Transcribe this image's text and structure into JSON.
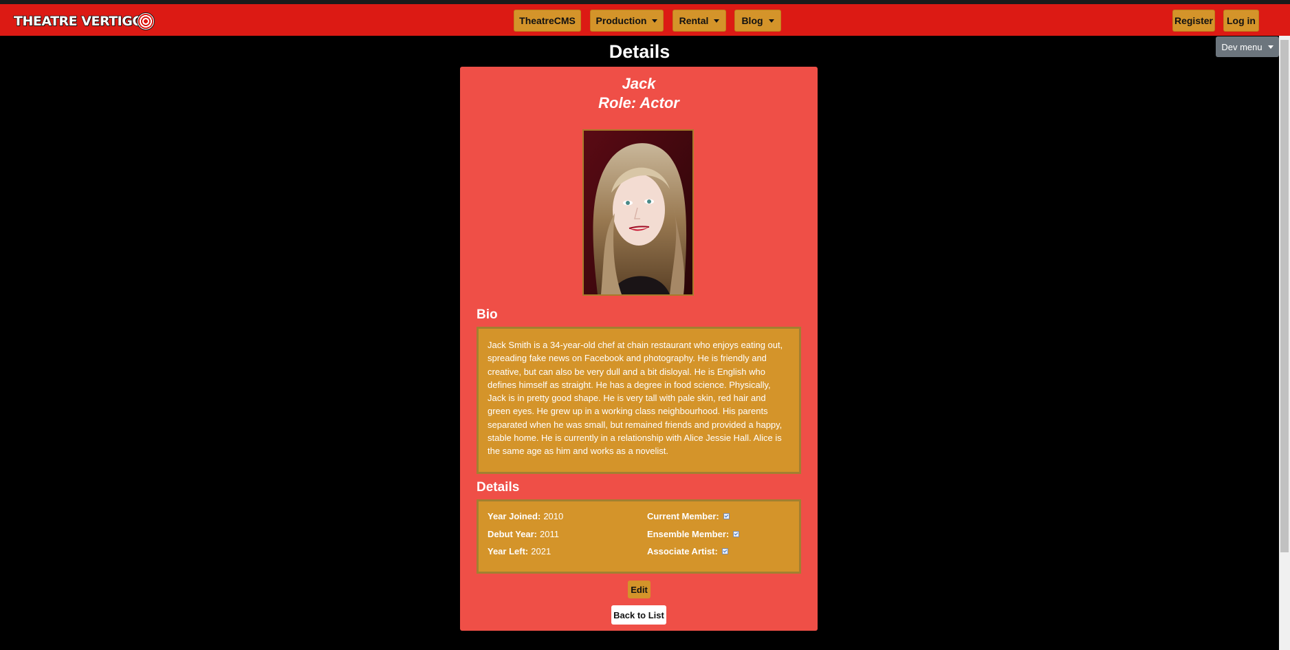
{
  "brand": {
    "logo_text": "THEATRE VERTIGO"
  },
  "nav": {
    "home_label": "TheatreCMS",
    "production_label": "Production",
    "rental_label": "Rental",
    "blog_label": "Blog",
    "register_label": "Register",
    "login_label": "Log in",
    "dev_menu_label": "Dev menu"
  },
  "page": {
    "title": "Details"
  },
  "member": {
    "name": "Jack",
    "role_line": "Role: Actor",
    "photo_icon": "portrait-photo",
    "bio_heading": "Bio",
    "bio": "Jack Smith is a 34-year-old chef at chain restaurant who enjoys eating out, spreading fake news on Facebook and photography. He is friendly and creative, but can also be very dull and a bit disloyal. He is English who defines himself as straight. He has a degree in food science. Physically, Jack is in pretty good shape. He is very tall with pale skin, red hair and green eyes. He grew up in a working class neighbourhood. His parents separated when he was small, but remained friends and provided a happy, stable home. He is currently in a relationship with Alice Jessie Hall. Alice is the same age as him and works as a novelist.",
    "details_heading": "Details",
    "details": {
      "year_joined_label": "Year Joined:",
      "year_joined": "2010",
      "debut_year_label": "Debut Year:",
      "debut_year": "2011",
      "year_left_label": "Year Left:",
      "year_left": "2021",
      "current_member_label": "Current Member:",
      "current_member": true,
      "ensemble_member_label": "Ensemble Member:",
      "ensemble_member": true,
      "associate_artist_label": "Associate Artist:",
      "associate_artist": true
    }
  },
  "actions": {
    "edit_label": "Edit",
    "back_label": "Back to List"
  },
  "colors": {
    "navbar": "#dc1a14",
    "card": "#ef4f47",
    "gold": "#d4942a",
    "background": "#000000"
  }
}
